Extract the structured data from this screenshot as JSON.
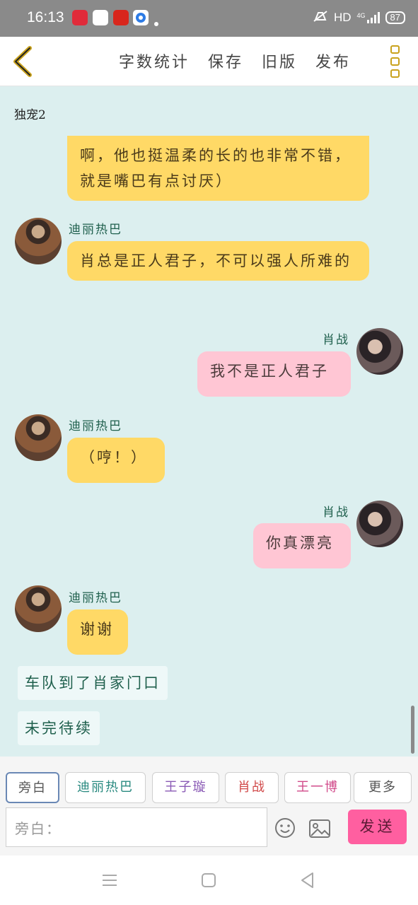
{
  "status_bar": {
    "time": "16:13",
    "network": "HD",
    "network_type": "4G",
    "battery": "87"
  },
  "header": {
    "actions": [
      "字数统计",
      "保存",
      "旧版",
      "发布"
    ]
  },
  "story": {
    "title": "独宠2"
  },
  "messages": [
    {
      "type": "other",
      "sender": "迪丽热巴",
      "text": "啊，他也挺温柔的长的也非常不错，就是嘴巴有点讨厌）"
    },
    {
      "type": "other",
      "sender": "迪丽热巴",
      "text": "肖总是正人君子，不可以强人所难的"
    },
    {
      "type": "self",
      "sender": "肖战",
      "text": "我不是正人君子"
    },
    {
      "type": "other",
      "sender": "迪丽热巴",
      "text": "（哼！）"
    },
    {
      "type": "self",
      "sender": "肖战",
      "text": "你真漂亮"
    },
    {
      "type": "other",
      "sender": "迪丽热巴",
      "text": "谢谢"
    },
    {
      "type": "narration",
      "text": "车队到了肖家门口"
    },
    {
      "type": "narration",
      "text": "未完待续"
    }
  ],
  "characters": [
    {
      "name": "旁白",
      "color": "#555555"
    },
    {
      "name": "迪丽热巴",
      "color": "#2a8a80"
    },
    {
      "name": "王子璇",
      "color": "#8a5ab5"
    },
    {
      "name": "肖战",
      "color": "#d14a4a"
    },
    {
      "name": "王一博",
      "color": "#d14a8a"
    },
    {
      "name": "更多",
      "color": "#555555"
    }
  ],
  "input": {
    "placeholder": "旁白："
  },
  "send_label": "发送",
  "icons": {
    "back": "back-chevron-icon",
    "more": "more-vertical-icon",
    "emoji": "emoji-icon",
    "image": "image-icon"
  }
}
